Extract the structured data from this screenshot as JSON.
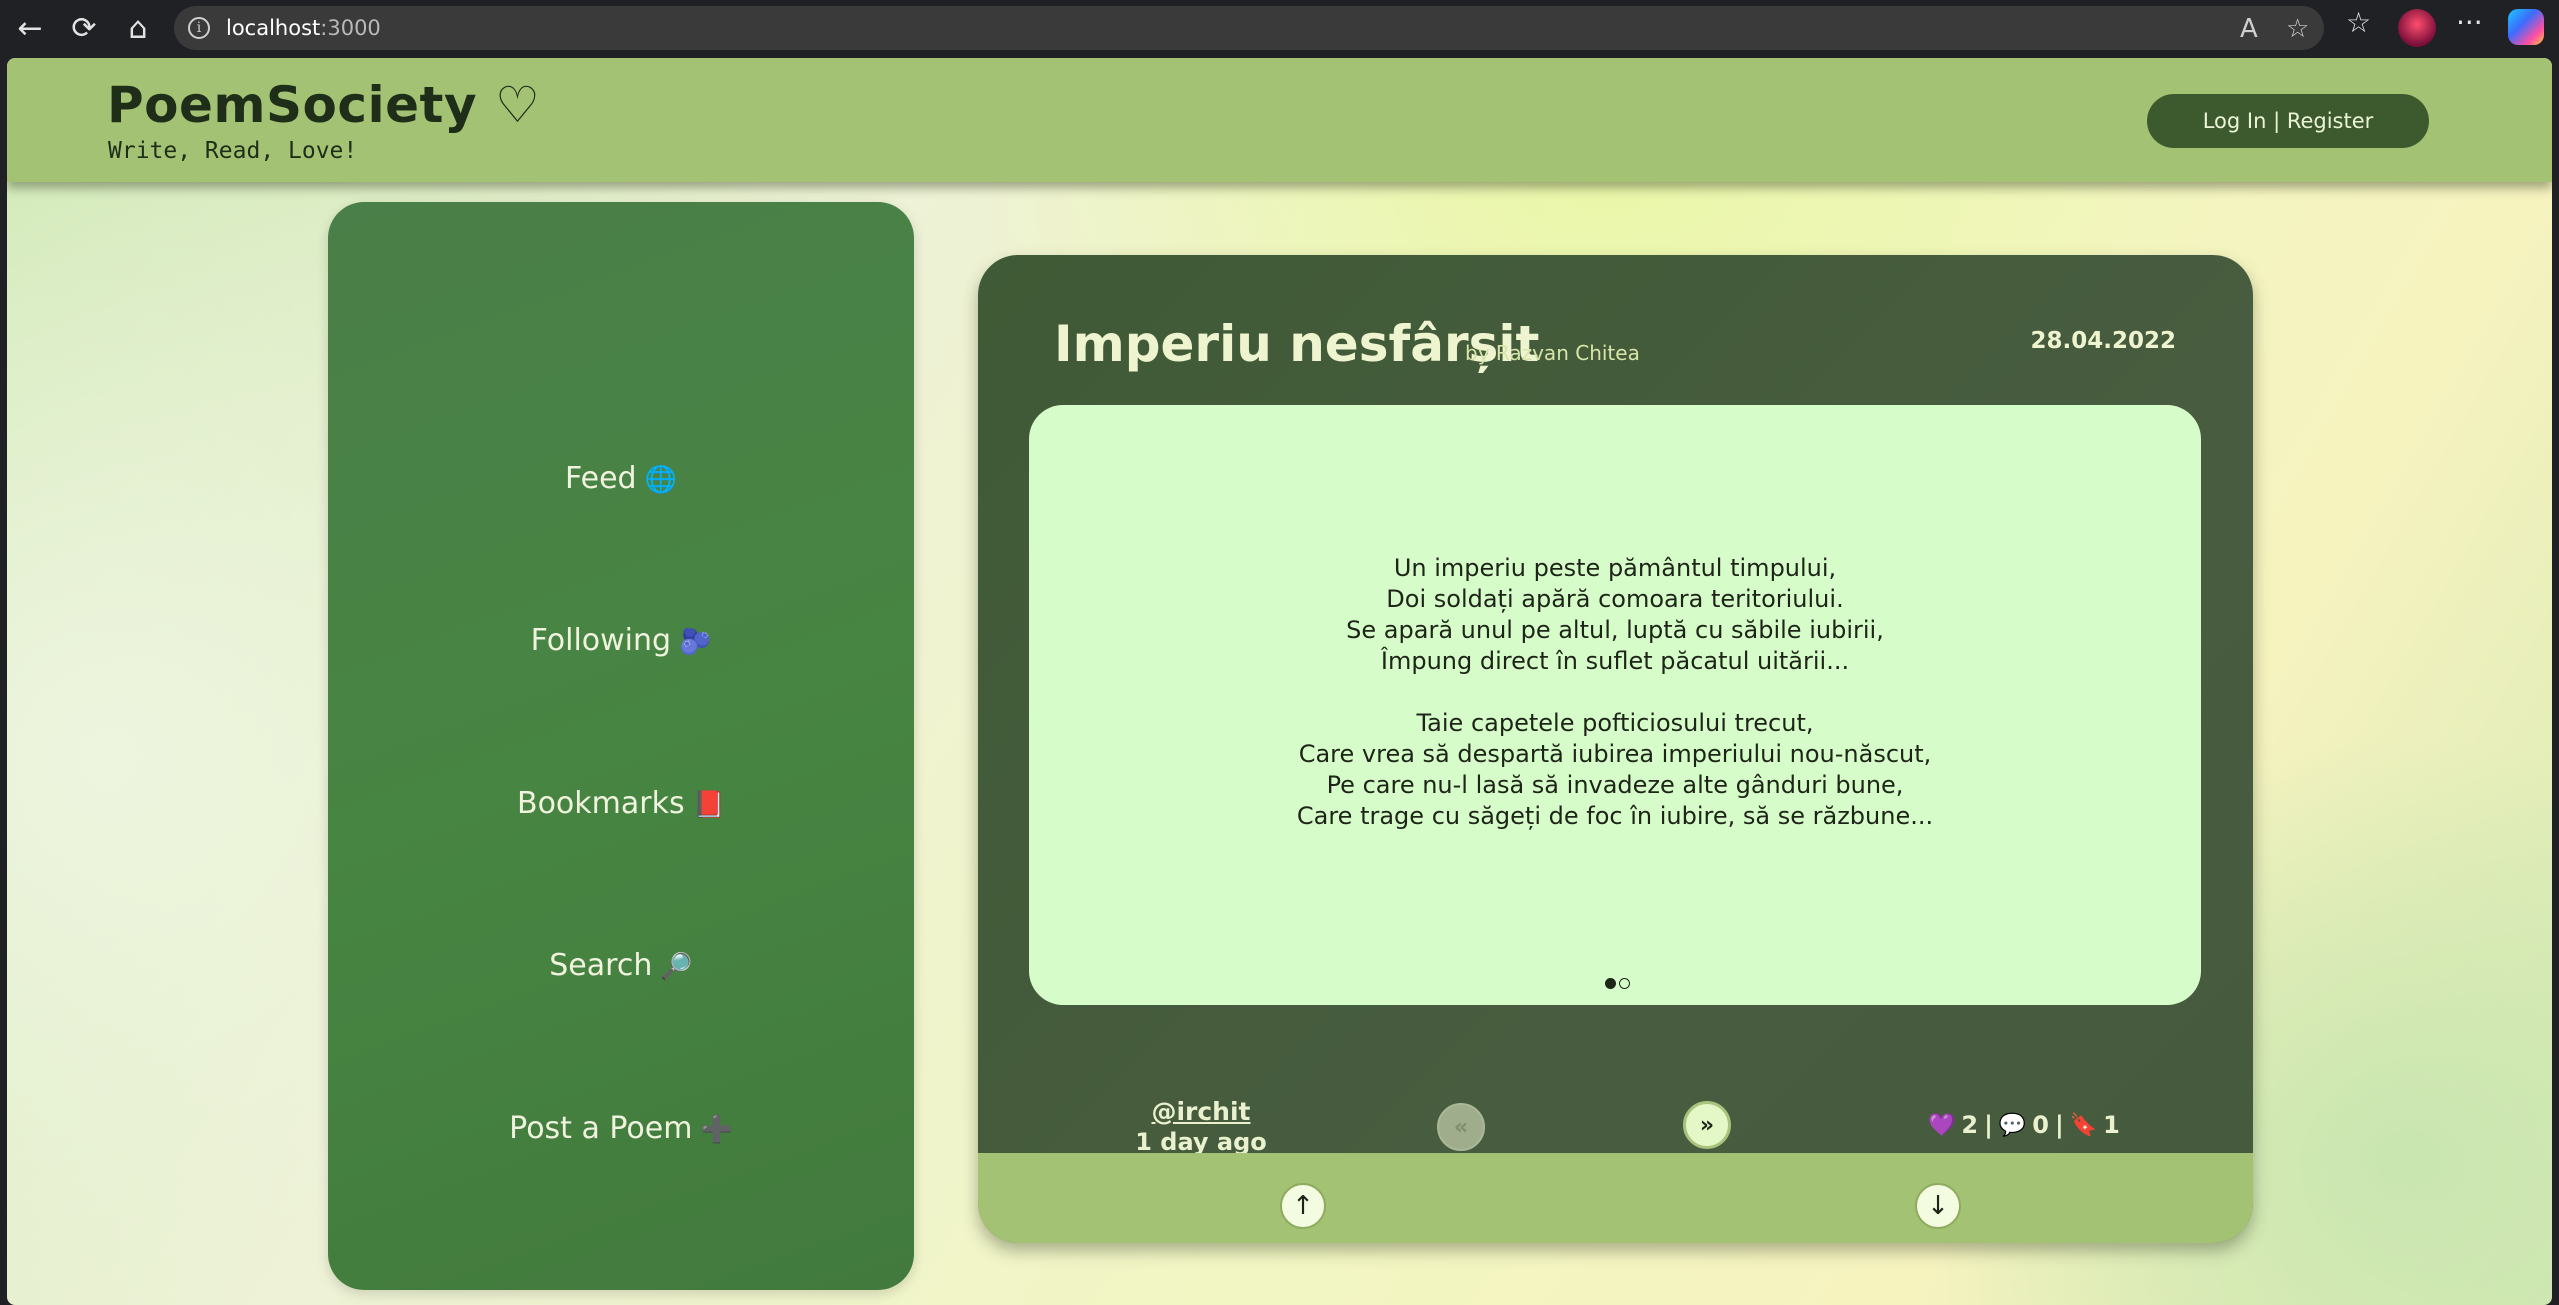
{
  "browser": {
    "url_host": "localhost",
    "url_port": ":3000",
    "icons": [
      "back-icon",
      "reload-icon",
      "home-icon",
      "info-icon",
      "read-aloud-icon",
      "favorite-icon",
      "favorites-bar-icon",
      "more-icon"
    ]
  },
  "site": {
    "logo": "PoemSociety ♡",
    "tagline": "Write, Read, Love!",
    "login_label": "Log In | Register"
  },
  "sidebar": {
    "items": [
      {
        "label": "Feed",
        "emoji": "🌐"
      },
      {
        "label": "Following",
        "emoji": "🫐"
      },
      {
        "label": "Bookmarks",
        "emoji": "📕"
      },
      {
        "label": "Search",
        "emoji": "🔎"
      },
      {
        "label": "Post a Poem",
        "emoji": "➕"
      }
    ]
  },
  "poem": {
    "title": "Imperiu nesfârșit",
    "author": "by Razvan Chitea",
    "date": "28.04.2022",
    "stanzas": [
      [
        "Un imperiu peste pământul timpului,",
        "Doi soldați apără comoara teritoriului.",
        "Se apară unul pe altul, luptă cu săbile iubirii,",
        "Împung direct în suflet păcatul uitării..."
      ],
      [
        "Taie capetele pofticiosului trecut,",
        "Care vrea să despartă iubirea imperiului nou-născut,",
        "Pe care nu-l lasă să invadeze alte gânduri bune,",
        "Care trage cu săgeți de foc în iubire, să se răzbune..."
      ]
    ],
    "page_indicator": {
      "current": 1,
      "total": 2
    },
    "user": "@irchit",
    "posted": "1 day ago",
    "prev_label": "«",
    "next_label": "»",
    "likes": "2",
    "comments": "0",
    "bookmarks": "1",
    "separator": "|",
    "up_label": "↑",
    "down_label": "↓"
  }
}
